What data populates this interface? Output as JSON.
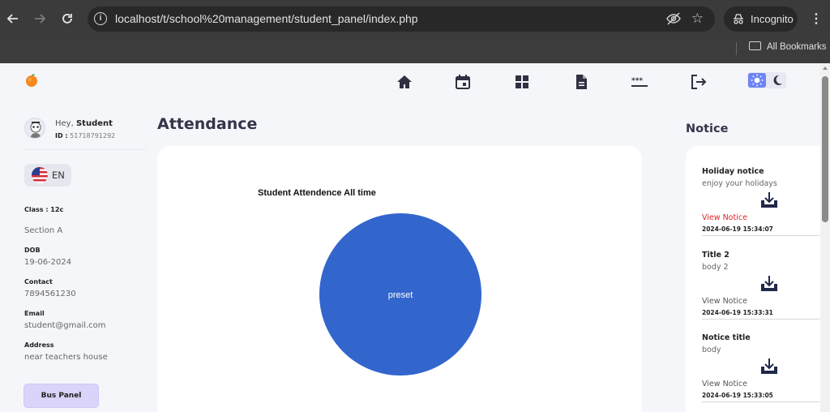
{
  "browser": {
    "url": "localhost/t/school%20management/student_panel/index.php",
    "profile_label": "Incognito",
    "bookmarks_label": "All Bookmarks"
  },
  "nav": {
    "items": [
      {
        "name": "home",
        "icon": "home-icon"
      },
      {
        "name": "calendar",
        "icon": "calendar-icon"
      },
      {
        "name": "dashboard",
        "icon": "grid-icon"
      },
      {
        "name": "document",
        "icon": "document-icon"
      },
      {
        "name": "password",
        "icon": "password-icon"
      },
      {
        "name": "logout",
        "icon": "logout-icon"
      }
    ],
    "theme": {
      "light_icon": "sun-icon",
      "dark_icon": "moon-icon",
      "active": "light"
    }
  },
  "profile": {
    "greeting": "Hey,",
    "name": "Student",
    "id_label": "ID :",
    "id_value": "51718791292",
    "language": "EN",
    "info": [
      {
        "label": "Class : 12c",
        "value": "Section A"
      },
      {
        "label": "DOB",
        "value": "19-06-2024"
      },
      {
        "label": "Contact",
        "value": "7894561230"
      },
      {
        "label": "Email",
        "value": "student@gmail.com"
      },
      {
        "label": "Address",
        "value": "near teachers house"
      }
    ],
    "bus_panel_label": "Bus Panel"
  },
  "attendance": {
    "title": "Attendance"
  },
  "chart_data": {
    "type": "pie",
    "title": "Student Attendence All time",
    "categories": [
      "preset"
    ],
    "values": [
      100
    ],
    "colors": [
      "#3366cc"
    ]
  },
  "notices": {
    "title": "Notice",
    "items": [
      {
        "title": "Holiday notice",
        "body": "enjoy your holidays",
        "link": "View Notice",
        "link_color": "#e02424",
        "date": "2024-06-19 15:34:07"
      },
      {
        "title": "Title 2",
        "body": "body 2",
        "link": "View Notice",
        "link_color": "#555555",
        "date": "2024-06-19 15:33:31"
      },
      {
        "title": "Notice title",
        "body": "body",
        "link": "View Notice",
        "link_color": "#555555",
        "date": "2024-06-19 15:33:05"
      }
    ]
  },
  "colors": {
    "accent": "#6e84f5",
    "nav_icon": "#2f3142",
    "pie": "#3366cc",
    "bus_button": "#dad3fa"
  }
}
